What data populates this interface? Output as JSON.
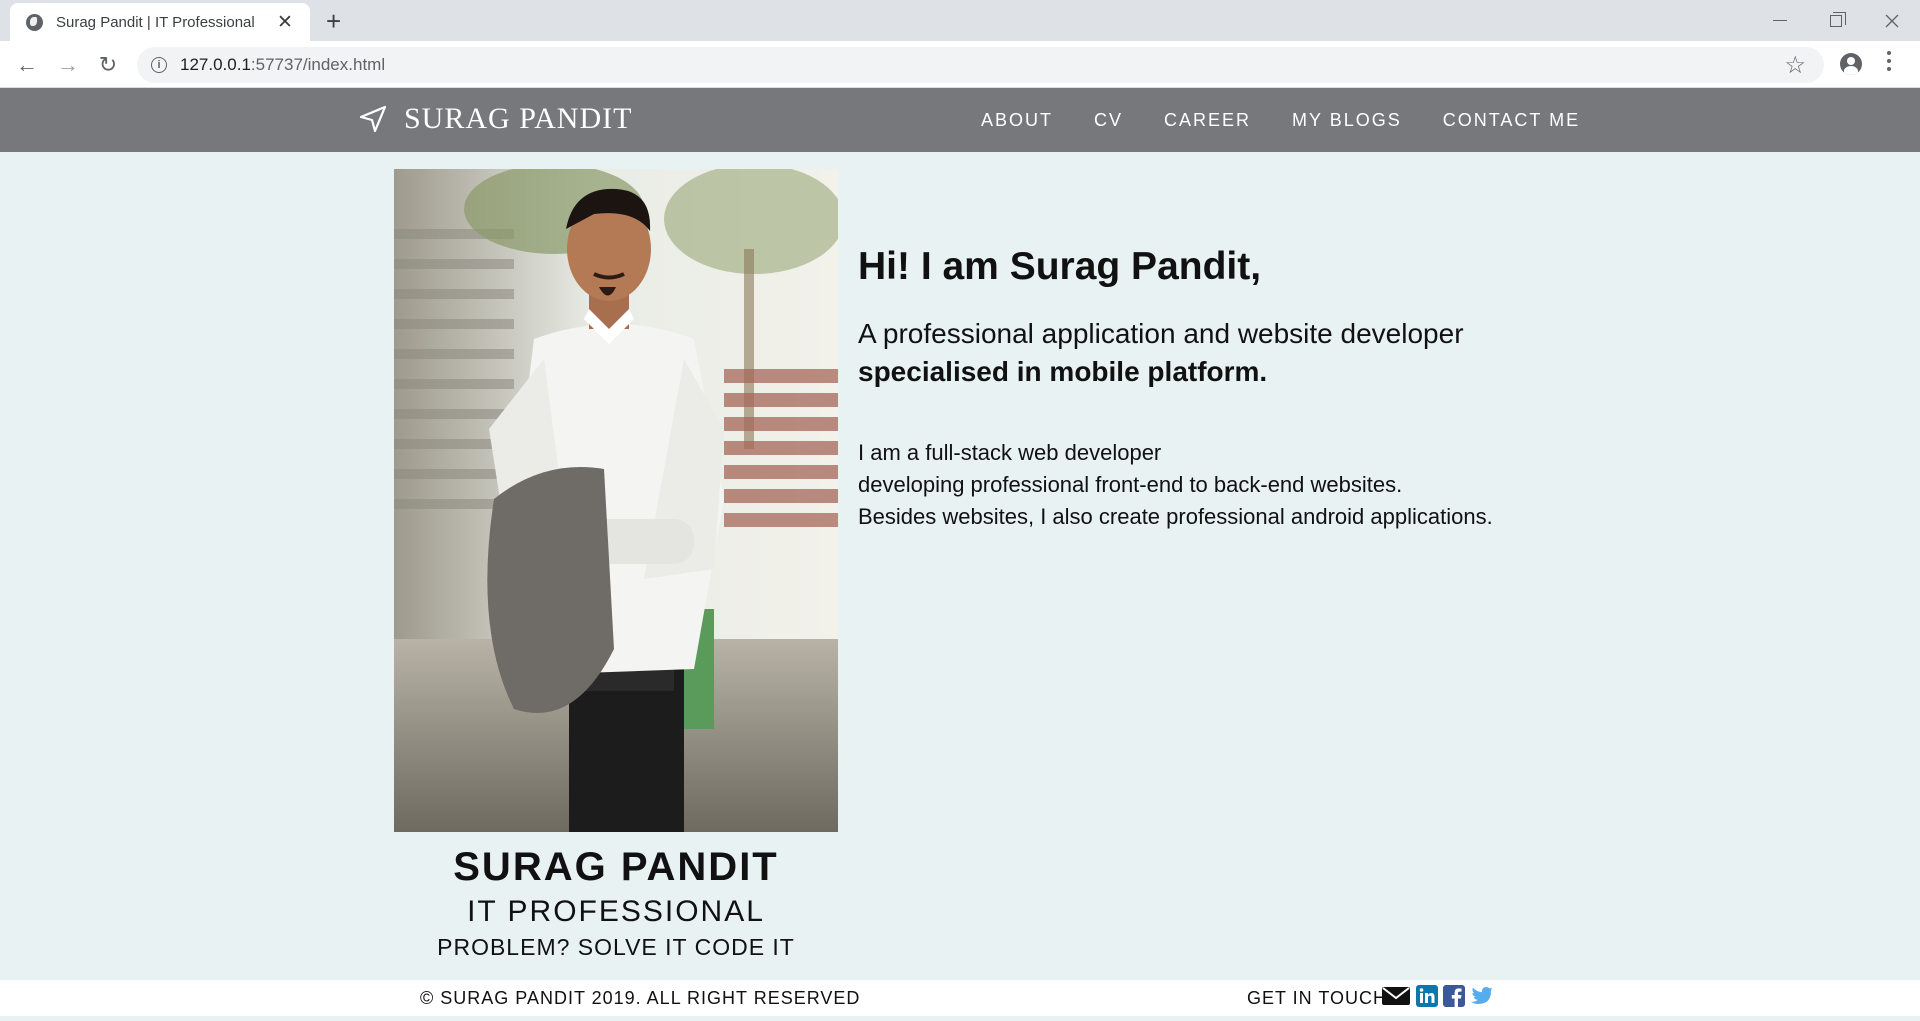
{
  "browser": {
    "tab_title": "Surag Pandit | IT Professional",
    "tab_close": "✕",
    "new_tab": "+",
    "url_host": "127.0.0.1",
    "url_rest": ":57737/index.html",
    "back": "←",
    "forward": "→",
    "reload": "↻",
    "star": "☆"
  },
  "site": {
    "brand": "SURAG PANDIT",
    "nav": [
      "ABOUT",
      "CV",
      "CAREER",
      "MY BLOGS",
      "CONTACT ME"
    ]
  },
  "profile": {
    "name": "SURAG PANDIT",
    "role": "IT PROFESSIONAL",
    "tagline": "PROBLEM? SOLVE IT CODE IT"
  },
  "intro": {
    "greeting": "Hi! I am Surag Pandit,",
    "subtitle_line1": "A professional application and website developer",
    "subtitle_line2": "specialised in mobile platform.",
    "description": [
      "I am a full-stack web developer",
      "developing professional front-end to back-end websites.",
      "Besides websites, I also create professional android applications."
    ]
  },
  "footer": {
    "copyright": "© SURAG PANDIT 2019. ALL RIGHT RESERVED",
    "get_in_touch": "GET IN TOUCH",
    "social_icons": [
      "email-icon",
      "linkedin-icon",
      "facebook-icon",
      "twitter-icon"
    ]
  },
  "colors": {
    "page_bg": "#e8f2f3",
    "nav_bg": "#76787c",
    "linkedin": "#0e76a8",
    "facebook": "#3b5998",
    "twitter": "#55acee"
  }
}
